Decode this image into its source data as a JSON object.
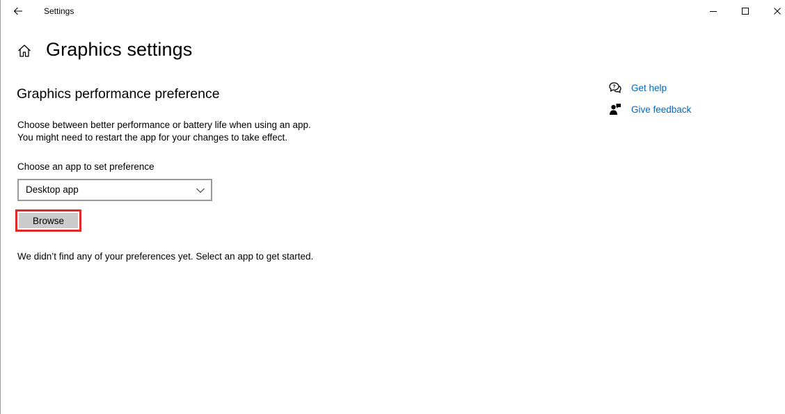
{
  "window": {
    "title": "Settings",
    "icons": {
      "back": "back-arrow-icon",
      "minimize": "minimize-icon",
      "maximize": "maximize-icon",
      "close": "close-icon"
    }
  },
  "header": {
    "title": "Graphics settings",
    "home_icon": "home-icon"
  },
  "main": {
    "section_title": "Graphics performance preference",
    "description_line1": "Choose between better performance or battery life when using an app.",
    "description_line2": "You might need to restart the app for your changes to take effect.",
    "choose_label": "Choose an app to set preference",
    "app_type_dropdown": {
      "selected": "Desktop app",
      "icon": "chevron-down-icon"
    },
    "browse_label": "Browse",
    "empty_message": "We didn’t find any of your preferences yet. Select an app to get started."
  },
  "side_links": {
    "get_help": {
      "label": "Get help",
      "icon": "get-help-icon"
    },
    "give_feedback": {
      "label": "Give feedback",
      "icon": "feedback-icon"
    }
  },
  "colors": {
    "link": "#0067c0",
    "highlight_border": "#e02a2a",
    "button_bg": "#cccccc",
    "dropdown_border": "#999999"
  }
}
